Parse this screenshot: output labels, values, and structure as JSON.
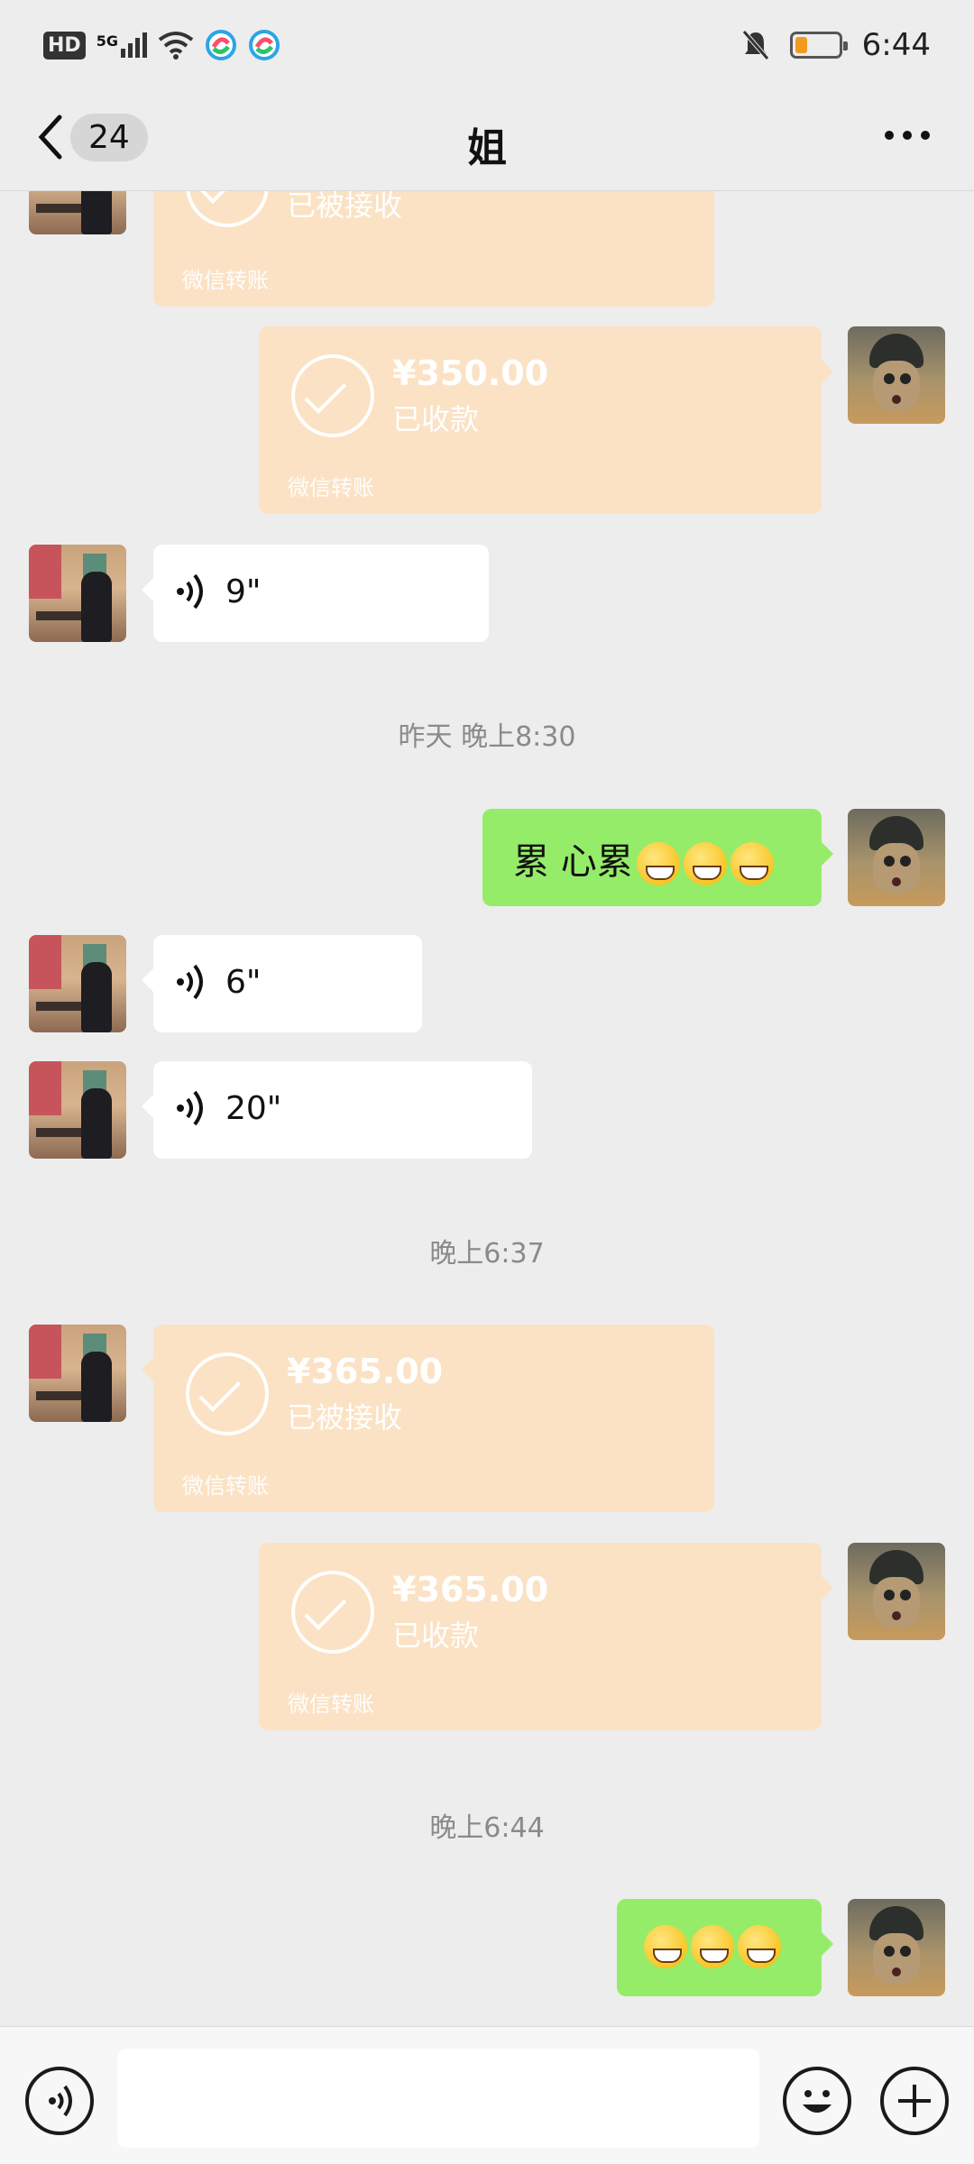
{
  "status_bar": {
    "hd_label": "HD",
    "network_label": "5G",
    "time": "6:44"
  },
  "header": {
    "unread_count": "24",
    "title": "姐"
  },
  "messages": {
    "t0": {
      "status": "已被接收",
      "footer": "微信转账"
    },
    "t1": {
      "amount": "¥350.00",
      "status": "已收款",
      "footer": "微信转账"
    },
    "v1": {
      "duration": "9\""
    },
    "ts1": "昨天 晚上8:30",
    "txt1": {
      "text": "累 心累"
    },
    "v2": {
      "duration": "6\""
    },
    "v3": {
      "duration": "20\""
    },
    "ts2": "晚上6:37",
    "t2": {
      "amount": "¥365.00",
      "status": "已被接收",
      "footer": "微信转账"
    },
    "t3": {
      "amount": "¥365.00",
      "status": "已收款",
      "footer": "微信转账"
    },
    "ts3": "晚上6:44"
  },
  "icons": {
    "back": "chevron-left-icon",
    "more": "more-dots-icon",
    "voice": "voice-wave-icon",
    "emoji": "smiley-icon",
    "plus": "plus-icon"
  },
  "colors": {
    "chat_bg": "#ededed",
    "my_bubble": "#95ec69",
    "transfer_bubble": "#fbe2c4"
  }
}
